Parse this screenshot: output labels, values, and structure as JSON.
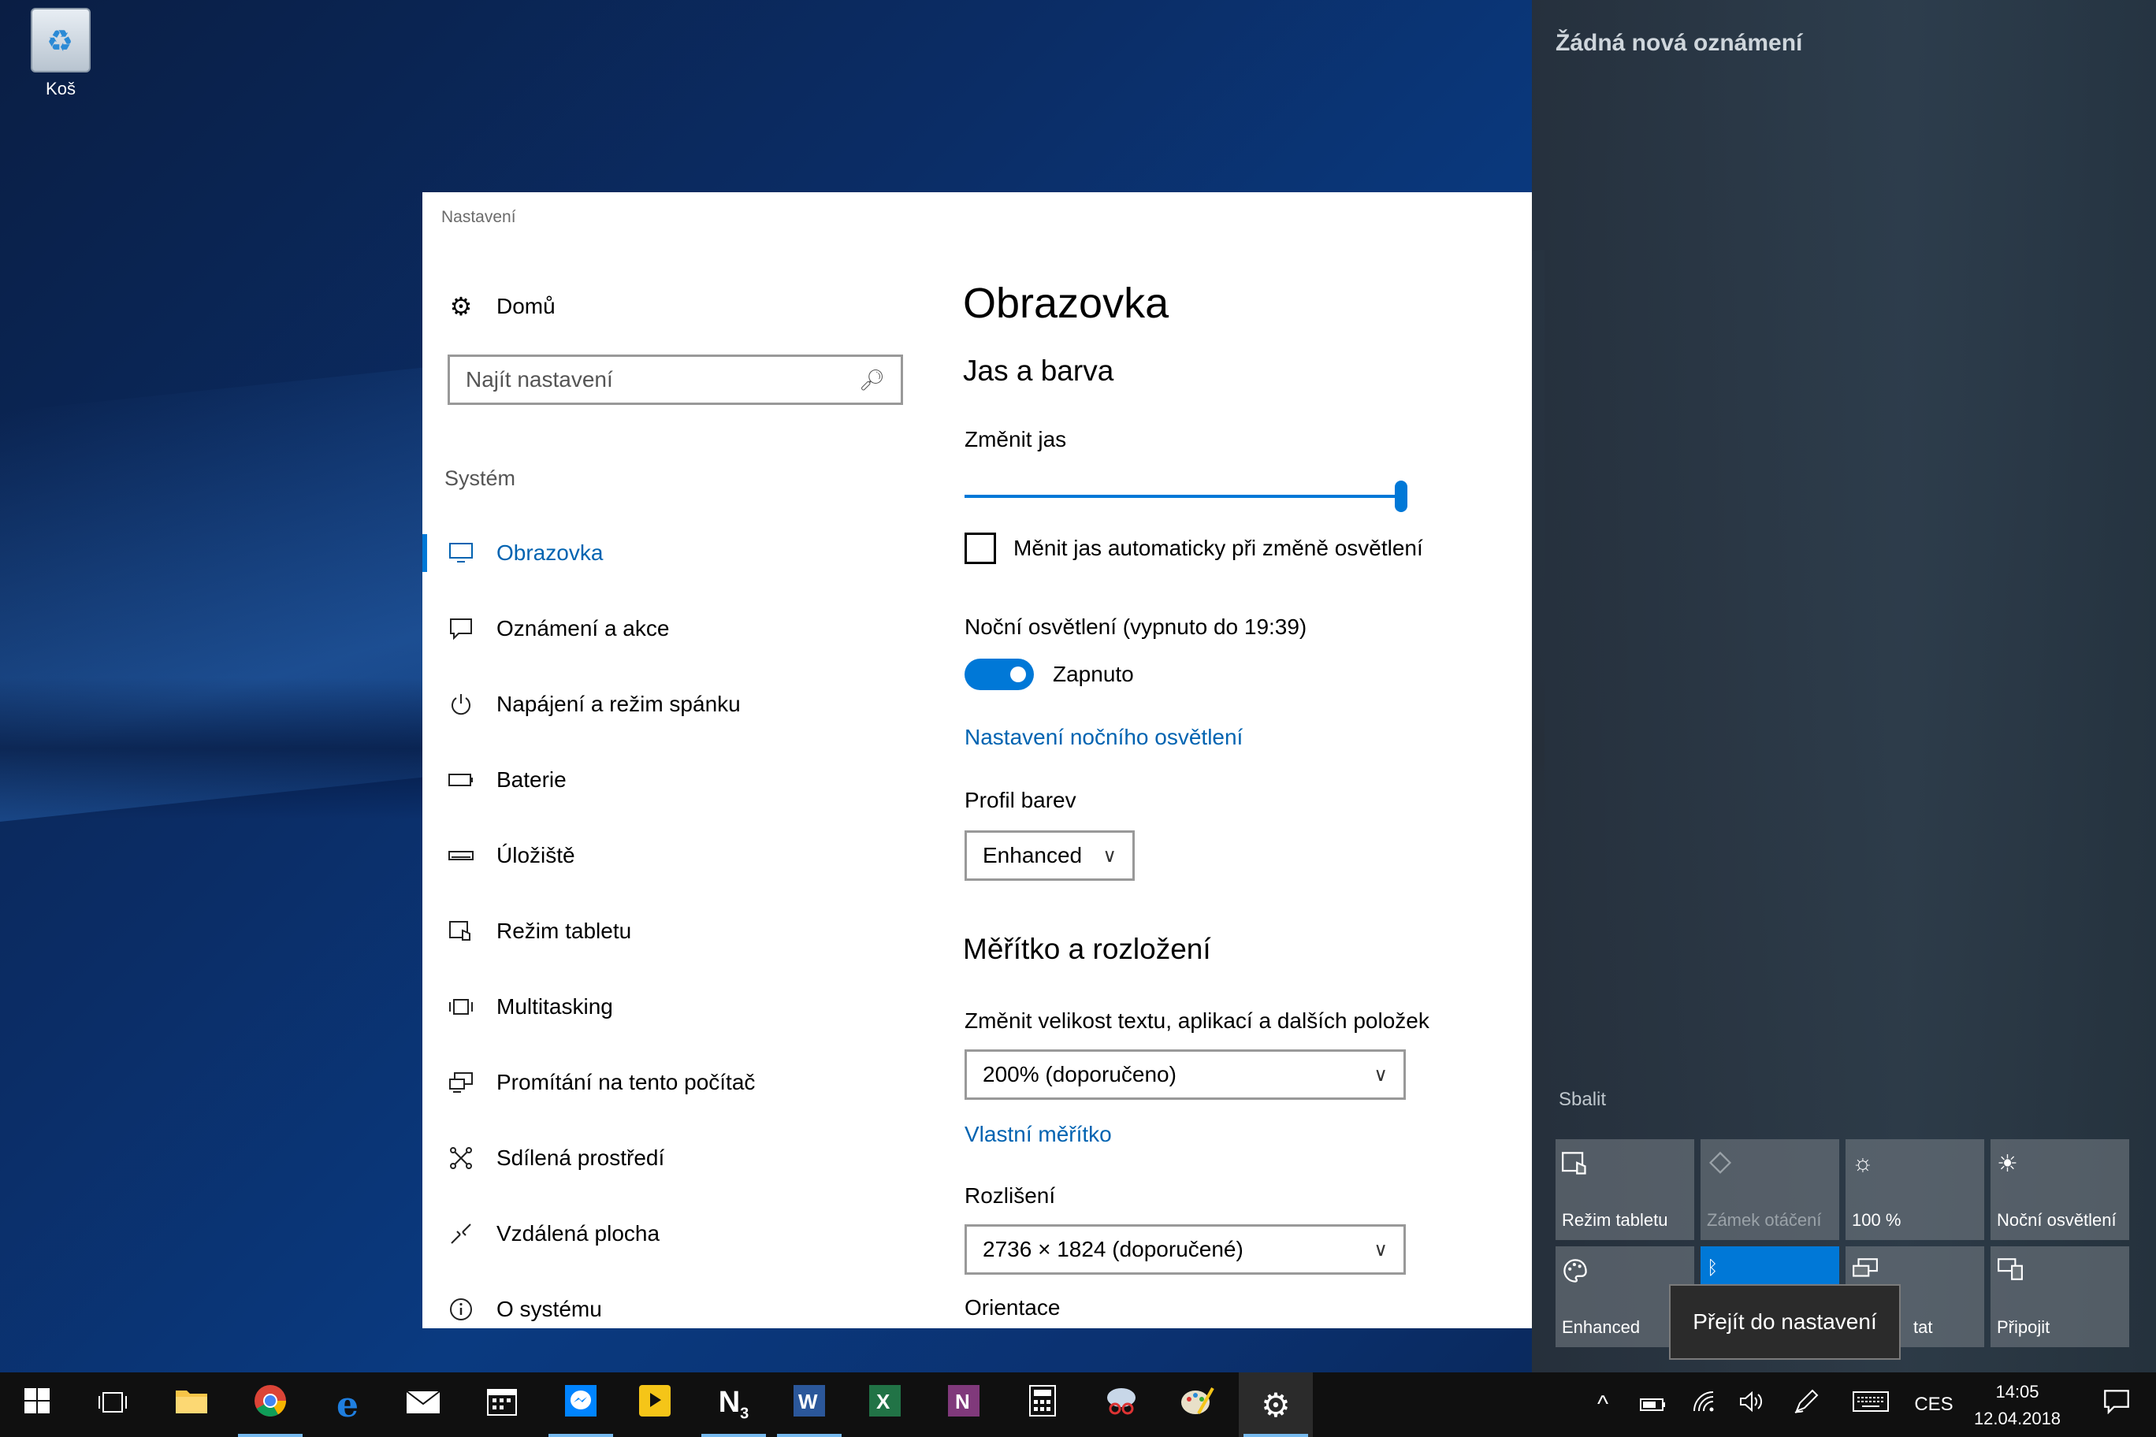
{
  "desktop": {
    "recycle_bin_label": "Koš"
  },
  "window": {
    "title": "Nastavení",
    "nav": {
      "home_label": "Domů",
      "search_placeholder": "Najít nastavení",
      "section_label": "Systém",
      "items": [
        {
          "label": "Obrazovka",
          "icon": "monitor-icon",
          "active": true
        },
        {
          "label": "Oznámení a akce",
          "icon": "notification-icon"
        },
        {
          "label": "Napájení a režim spánku",
          "icon": "power-icon"
        },
        {
          "label": "Baterie",
          "icon": "battery-icon"
        },
        {
          "label": "Úložiště",
          "icon": "storage-icon"
        },
        {
          "label": "Režim tabletu",
          "icon": "tablet-mode-icon"
        },
        {
          "label": "Multitasking",
          "icon": "multitasking-icon"
        },
        {
          "label": "Promítání na tento počítač",
          "icon": "projecting-icon"
        },
        {
          "label": "Sdílená prostředí",
          "icon": "shared-experiences-icon"
        },
        {
          "label": "Vzdálená plocha",
          "icon": "remote-desktop-icon"
        },
        {
          "label": "O systému",
          "icon": "info-icon"
        }
      ]
    },
    "content": {
      "page_title": "Obrazovka",
      "brightness_heading": "Jas a barva",
      "brightness_label": "Změnit jas",
      "brightness_value": 1.0,
      "auto_brightness_label": "Měnit jas automaticky při změně osvětlení",
      "auto_brightness_checked": false,
      "night_light_label": "Noční osvětlení (vypnuto do 19:39)",
      "night_light_state": "Zapnuto",
      "night_light_link": "Nastavení nočního osvětlení",
      "color_profile_label": "Profil barev",
      "color_profile_value": "Enhanced",
      "scale_heading": "Měřítko a rozložení",
      "scale_label": "Změnit velikost textu, aplikací a dalších položek",
      "scale_value": "200% (doporučeno)",
      "custom_scale_link": "Vlastní měřítko",
      "resolution_label": "Rozlišení",
      "resolution_value": "2736 × 1824 (doporučené)",
      "orientation_label": "Orientace"
    }
  },
  "action_center": {
    "title": "Žádná nová oznámení",
    "collapse_label": "Sbalit",
    "tiles": [
      {
        "label": "Režim tabletu",
        "icon": "tablet-mode-icon",
        "state": "normal"
      },
      {
        "label": "Zámek otáčení",
        "icon": "rotation-lock-icon",
        "state": "disabled"
      },
      {
        "label": "100 %",
        "icon": "brightness-icon",
        "state": "normal"
      },
      {
        "label": "Noční osvětlení",
        "icon": "night-light-icon",
        "state": "normal"
      },
      {
        "label": "Enhanced",
        "icon": "color-profile-icon",
        "state": "normal"
      },
      {
        "label": "",
        "icon": "bluetooth-icon",
        "state": "active"
      },
      {
        "label": "tat",
        "icon": "project-icon",
        "state": "normal"
      },
      {
        "label": "Připojit",
        "icon": "connect-icon",
        "state": "normal"
      }
    ],
    "tooltip": "Přejít do nastavení"
  },
  "taskbar": {
    "apps": [
      {
        "name": "start",
        "icon": "windows-icon"
      },
      {
        "name": "task-view",
        "icon": "task-view-icon"
      },
      {
        "name": "file-explorer",
        "icon": "folder-icon"
      },
      {
        "name": "chrome",
        "icon": "chrome-icon",
        "running": true
      },
      {
        "name": "edge",
        "icon": "edge-icon"
      },
      {
        "name": "mail",
        "icon": "mail-icon"
      },
      {
        "name": "calendar",
        "icon": "calendar-icon"
      },
      {
        "name": "messenger",
        "icon": "messenger-icon",
        "running": true
      },
      {
        "name": "player",
        "icon": "player-icon"
      },
      {
        "name": "app-n3",
        "icon": "n3-icon",
        "running": true
      },
      {
        "name": "word",
        "icon": "word-icon",
        "running": true
      },
      {
        "name": "excel",
        "icon": "excel-icon"
      },
      {
        "name": "onenote",
        "icon": "onenote-icon"
      },
      {
        "name": "calculator",
        "icon": "calculator-icon"
      },
      {
        "name": "snipping",
        "icon": "snipping-icon"
      },
      {
        "name": "paint",
        "icon": "paint-icon"
      },
      {
        "name": "settings",
        "icon": "gear-icon",
        "running": true,
        "active": true
      }
    ],
    "language": "CES",
    "time": "14:05",
    "date": "12.04.2018"
  }
}
